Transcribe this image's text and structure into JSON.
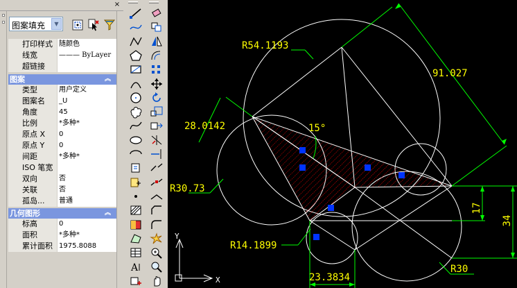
{
  "properties_palette": {
    "close_glyph": "×",
    "object_type_selector": {
      "selected": "图案填充"
    },
    "general_rows": [
      {
        "label": "打印样式",
        "value": "随颜色"
      },
      {
        "label": "线宽",
        "value": "——— ByLayer"
      },
      {
        "label": "超链接",
        "value": ""
      }
    ],
    "pattern_section": {
      "title": "图案",
      "rows": [
        {
          "label": "类型",
          "value": "用户定义"
        },
        {
          "label": "图案名",
          "value": "_U"
        },
        {
          "label": "角度",
          "value": "45"
        },
        {
          "label": "比例",
          "value": "*多种*"
        },
        {
          "label": "原点 X",
          "value": "0"
        },
        {
          "label": "原点 Y",
          "value": "0"
        },
        {
          "label": "间距",
          "value": "*多种*"
        },
        {
          "label": "ISO 笔宽",
          "value": ""
        },
        {
          "label": "双向",
          "value": "否"
        },
        {
          "label": "关联",
          "value": "否"
        },
        {
          "label": "孤岛...",
          "value": "普通"
        }
      ]
    },
    "geometry_section": {
      "title": "几何图形",
      "rows": [
        {
          "label": "标高",
          "value": "0"
        },
        {
          "label": "面积",
          "value": "*多种*"
        },
        {
          "label": "累计面积",
          "value": "1975.8088"
        }
      ]
    },
    "icons": [
      "quick-select-icon",
      "select-objects-icon",
      "toggle-pickadd-icon"
    ]
  },
  "toolbars": {
    "draw": [
      "line-icon",
      "construction-line-icon",
      "polyline-icon",
      "polygon-icon",
      "rectangle-icon",
      "arc-icon",
      "circle-icon",
      "revision-cloud-icon",
      "spline-icon",
      "ellipse-icon",
      "ellipse-arc-icon",
      "insert-block-icon",
      "make-block-icon",
      "point-icon",
      "hatch-icon",
      "gradient-icon",
      "region-icon",
      "table-icon",
      "multiline-text-icon",
      "add-selected-icon"
    ],
    "modify": [
      "erase-icon",
      "copy-icon",
      "mirror-icon",
      "offset-icon",
      "array-icon",
      "move-icon",
      "rotate-icon",
      "scale-icon",
      "stretch-icon",
      "trim-icon",
      "extend-icon",
      "break-at-point-icon",
      "break-icon",
      "join-icon",
      "chamfer-icon",
      "fillet-icon",
      "explode-icon",
      "zoom-realtime-icon",
      "zoom-window-icon",
      "pan-icon"
    ]
  },
  "drawing": {
    "colors": {
      "background": "#000000",
      "geometry": "#ffffff",
      "dimension": "#00ff00",
      "dimension_text": "#ffff00",
      "hatch": "#ff0000",
      "grip": "#0033ff"
    },
    "dimensions": {
      "big_radius": "R54.1193",
      "slant_length": "91.027",
      "chord": "28.0142",
      "angle": "15°",
      "left_radius": "R30.73",
      "small_radius": "R14.1899",
      "height_small": "17",
      "height_large": "34",
      "bottom_width": "23.3834",
      "right_radius": "R30"
    },
    "ucs_icon": {
      "x_label": "X",
      "y_label": "Y"
    }
  }
}
